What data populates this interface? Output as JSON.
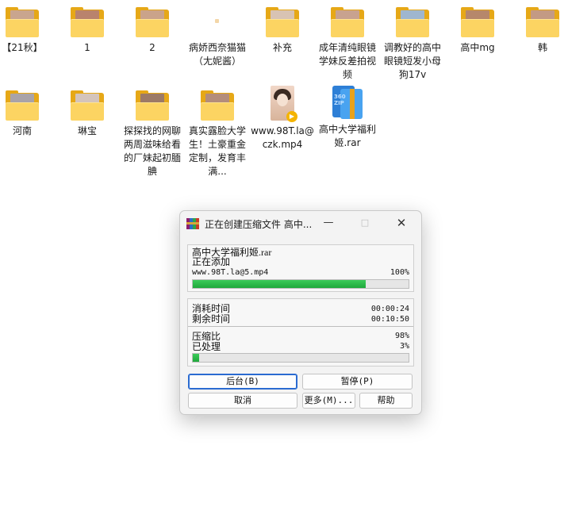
{
  "desktop": {
    "items": [
      {
        "label": "【21秋】",
        "type": "folder",
        "photo": "#c9a58e"
      },
      {
        "label": "1",
        "type": "folder",
        "photo": "#b9836d"
      },
      {
        "label": "2",
        "type": "folder",
        "photo": "#caa38a"
      },
      {
        "label": "病娇西奈猫猫（尢妮酱）",
        "type": "blank"
      },
      {
        "label": "补充",
        "type": "folder",
        "photo": "#d8c3b3"
      },
      {
        "label": "成年清纯眼镜学妹反差拍视频",
        "type": "folder",
        "photo": "#c8a28f"
      },
      {
        "label": "调教好的高中眼镜短发小母狗17v",
        "type": "folder",
        "photo": "#9fb6cf"
      },
      {
        "label": "高中mg",
        "type": "folder",
        "photo": "#b6876b"
      },
      {
        "label": "韩",
        "type": "folder",
        "photo": "#c39a84"
      },
      {
        "label": "河南",
        "type": "folder",
        "photo": "#a9a3a8"
      },
      {
        "label": "琳宝",
        "type": "folder",
        "photo": "#d4c4bb"
      },
      {
        "label": "探探找的网聊两周滋味给看的厂妹起初腼腆",
        "type": "folder",
        "photo": "#9c7a66"
      },
      {
        "label": "真实露脸大学生！土豪重金定制，发育丰满...",
        "type": "folder",
        "photo": "#b48d7b"
      },
      {
        "label": "www.98T.la@czk.mp4",
        "type": "video"
      },
      {
        "label": "高中大学福利姬.rar",
        "type": "rar"
      }
    ]
  },
  "dialog": {
    "title": "正在创建压缩文件 高中...",
    "archive_name": "高中大学福利姬.rar",
    "status": "正在添加",
    "current_file": "www.98T.la@5.mp4",
    "file_percent_text": "100%",
    "file_progress": 0.8,
    "elapsed_label": "消耗时间",
    "elapsed_value": "00:00:24",
    "remaining_label": "剩余时间",
    "remaining_value": "00:10:50",
    "ratio_label": "压缩比",
    "ratio_value": "98%",
    "processed_label": "已处理",
    "processed_value": "3%",
    "total_progress": 0.03,
    "buttons": {
      "background": "后台(B)",
      "pause": "暂停(P)",
      "cancel": "取消",
      "more": "更多(M)...",
      "help": "帮助"
    }
  },
  "colors": {
    "progress": "#1fa83b",
    "folder": "#fcd462",
    "accent": "#2a6bd1"
  }
}
